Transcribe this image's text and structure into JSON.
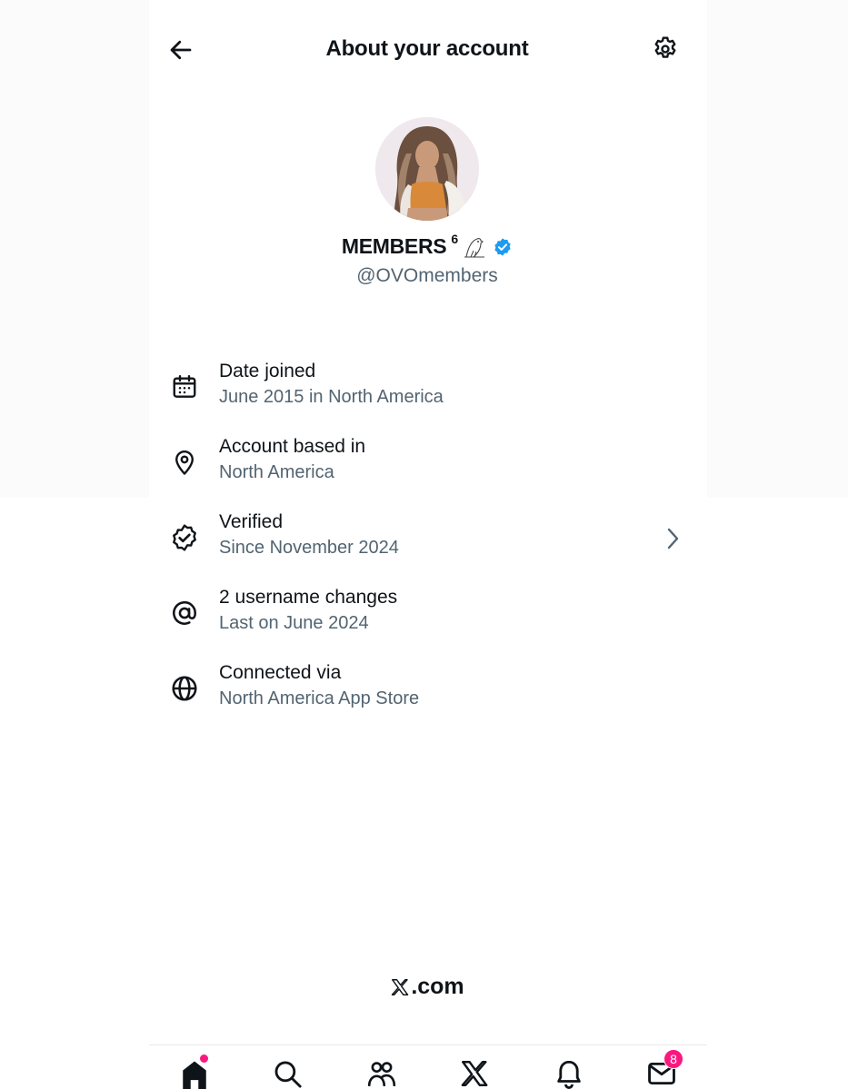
{
  "header": {
    "title": "About your account",
    "back_icon": "arrow-left-icon",
    "settings_icon": "gear-icon"
  },
  "profile": {
    "display_name": "MEMBERS",
    "name_superscript": "6",
    "name_emoji": "owl",
    "verified": true,
    "handle": "@OVOmembers"
  },
  "info": [
    {
      "icon": "calendar-icon",
      "title": "Date joined",
      "subtitle": "June 2015 in North America",
      "has_chevron": false
    },
    {
      "icon": "location-pin-icon",
      "title": "Account based in",
      "subtitle": "North America",
      "has_chevron": false
    },
    {
      "icon": "verified-check-icon",
      "title": "Verified",
      "subtitle": "Since November 2024",
      "has_chevron": true
    },
    {
      "icon": "at-sign-icon",
      "title": "2 username changes",
      "subtitle": "Last on June 2024",
      "has_chevron": false
    },
    {
      "icon": "globe-icon",
      "title": "Connected via",
      "subtitle": "North America App Store",
      "has_chevron": false
    }
  ],
  "footer": {
    "brand_suffix": ".com",
    "brand_icon": "x-logo-icon"
  },
  "nav": {
    "items": [
      "home-icon",
      "search-icon",
      "communities-icon",
      "x-logo-icon",
      "notifications-bell-icon",
      "messages-mail-icon"
    ],
    "messages_badge": "8",
    "home_has_dot": true
  },
  "colors": {
    "text_primary": "#0f1419",
    "text_secondary": "#536471",
    "verified_blue": "#1d9bf0",
    "badge_pink": "#f91880"
  }
}
